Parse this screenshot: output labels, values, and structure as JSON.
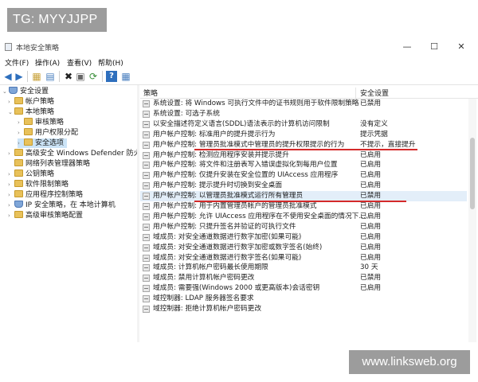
{
  "overlay": {
    "tg_label": "TG: MYYJJPP",
    "watermark": "www.linksweb.org"
  },
  "window": {
    "title": "本地安全策略",
    "controls": {
      "minimize": "—",
      "maximize": "☐",
      "close": "✕"
    }
  },
  "menu": [
    "文件(F)",
    "操作(A)",
    "查看(V)",
    "帮助(H)"
  ],
  "toolbar": {
    "back": "◀",
    "forward": "▶",
    "up": "▦",
    "show_tree": "▤",
    "delete": "✖",
    "properties": "▣",
    "refresh": "⟳",
    "export": "▥",
    "help": "?",
    "view": "▦"
  },
  "tree": [
    {
      "label": "安全设置",
      "level": 0,
      "expander": "⌄",
      "icon": "shield-icon",
      "selected": false
    },
    {
      "label": "帐户策略",
      "level": 1,
      "expander": "›",
      "icon": "folder-icon",
      "selected": false
    },
    {
      "label": "本地策略",
      "level": 1,
      "expander": "⌄",
      "icon": "folder-icon",
      "selected": false
    },
    {
      "label": "审核策略",
      "level": 2,
      "expander": "›",
      "icon": "folder-icon",
      "selected": false
    },
    {
      "label": "用户权限分配",
      "level": 2,
      "expander": "›",
      "icon": "folder-icon",
      "selected": false
    },
    {
      "label": "安全选项",
      "level": 2,
      "expander": "›",
      "icon": "folder-icon",
      "selected": true
    },
    {
      "label": "高级安全 Windows Defender 防火墙",
      "level": 1,
      "expander": "›",
      "icon": "folder-icon",
      "selected": false
    },
    {
      "label": "网络列表管理器策略",
      "level": 1,
      "expander": "",
      "icon": "folder-icon",
      "selected": false
    },
    {
      "label": "公钥策略",
      "level": 1,
      "expander": "›",
      "icon": "folder-icon",
      "selected": false
    },
    {
      "label": "软件限制策略",
      "level": 1,
      "expander": "›",
      "icon": "folder-icon",
      "selected": false
    },
    {
      "label": "应用程序控制策略",
      "level": 1,
      "expander": "›",
      "icon": "folder-icon",
      "selected": false
    },
    {
      "label": "IP 安全策略，在 本地计算机",
      "level": 1,
      "expander": "›",
      "icon": "shield-icon",
      "selected": false
    },
    {
      "label": "高级审核策略配置",
      "level": 1,
      "expander": "›",
      "icon": "folder-icon",
      "selected": false
    }
  ],
  "list": {
    "columns": [
      "策略",
      "安全设置"
    ],
    "rows": [
      {
        "policy": "系统设置: 将 Windows 可执行文件中的证书规则用于软件限制策略",
        "setting": "已禁用"
      },
      {
        "policy": "系统设置: 可选子系统",
        "setting": ""
      },
      {
        "policy": "以安全描述符定义语言(SDDL)语法表示的计算机访问限制",
        "setting": "没有定义"
      },
      {
        "policy": "用户帐户控制: 标准用户的提升提示行为",
        "setting": "提示凭据"
      },
      {
        "policy": "用户帐户控制: 管理员批准模式中管理员的提升权限提示的行为",
        "setting": "不提示，直接提升"
      },
      {
        "policy": "用户帐户控制: 检测应用程序安装并提示提升",
        "setting": "已启用"
      },
      {
        "policy": "用户帐户控制: 将文件和注册表写入错误虚拟化到每用户位置",
        "setting": "已启用"
      },
      {
        "policy": "用户帐户控制: 仅提升安装在安全位置的 UIAccess 应用程序",
        "setting": "已启用"
      },
      {
        "policy": "用户帐户控制: 提示提升时切换到安全桌面",
        "setting": "已启用"
      },
      {
        "policy": "用户帐户控制: 以管理员批准模式运行所有管理员",
        "setting": "已禁用"
      },
      {
        "policy": "用户帐户控制: 用于内置管理员帐户的管理员批准模式",
        "setting": "已启用"
      },
      {
        "policy": "用户帐户控制: 允许 UIAccess 应用程序在不使用安全桌面的情况下...",
        "setting": "已启用"
      },
      {
        "policy": "用户帐户控制: 只提升签名并验证的可执行文件",
        "setting": "已启用"
      },
      {
        "policy": "域成员: 对安全通道数据进行数字加密(如果可能)",
        "setting": "已启用"
      },
      {
        "policy": "域成员: 对安全通道数据进行数字加密或数字签名(始终)",
        "setting": "已启用"
      },
      {
        "policy": "域成员: 对安全通道数据进行数字签名(如果可能)",
        "setting": "已启用"
      },
      {
        "policy": "域成员: 计算机帐户密码最长使用期限",
        "setting": "30 天"
      },
      {
        "policy": "域成员: 禁用计算机帐户密码更改",
        "setting": "已禁用"
      },
      {
        "policy": "域成员: 需要强(Windows 2000 或更高版本)会话密钥",
        "setting": "已启用"
      },
      {
        "policy": "域控制器: LDAP 服务器签名要求",
        "setting": ""
      },
      {
        "policy": "域控制器: 拒绝计算机帐户密码更改",
        "setting": ""
      }
    ]
  },
  "accent": {
    "highlight_line": "#d42a2a",
    "selection": "#cce4f7"
  }
}
